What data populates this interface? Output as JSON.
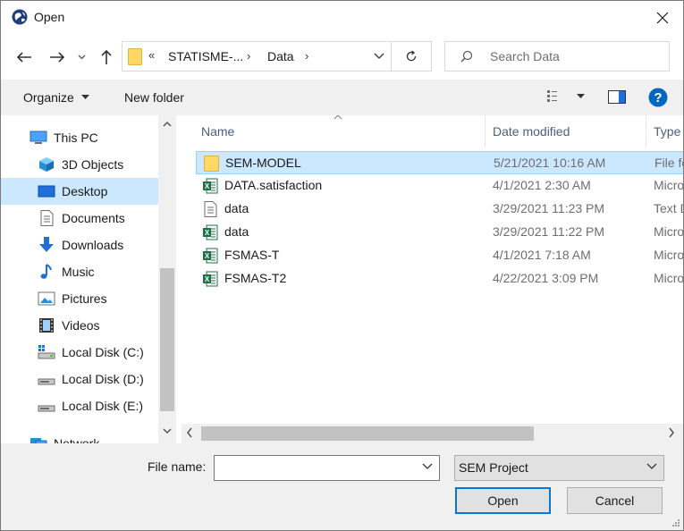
{
  "window": {
    "title": "Open"
  },
  "address": {
    "overflow": "«",
    "crumbs": [
      "STATISME-...",
      "Data"
    ]
  },
  "search": {
    "placeholder": "Search Data"
  },
  "toolbar": {
    "organize": "Organize",
    "new_folder": "New folder"
  },
  "sidebar": {
    "items": [
      {
        "label": "This PC",
        "icon": "computer-icon"
      },
      {
        "label": "3D Objects",
        "icon": "cube-icon"
      },
      {
        "label": "Desktop",
        "icon": "desktop-icon",
        "selected": true
      },
      {
        "label": "Documents",
        "icon": "document-icon"
      },
      {
        "label": "Downloads",
        "icon": "download-arrow-icon"
      },
      {
        "label": "Music",
        "icon": "music-note-icon"
      },
      {
        "label": "Pictures",
        "icon": "picture-icon"
      },
      {
        "label": "Videos",
        "icon": "film-icon"
      },
      {
        "label": "Local Disk (C:)",
        "icon": "drive-windows-icon"
      },
      {
        "label": "Local Disk (D:)",
        "icon": "drive-icon"
      },
      {
        "label": "Local Disk (E:)",
        "icon": "drive-icon"
      },
      {
        "label": "Network",
        "icon": "network-icon"
      }
    ]
  },
  "columns": {
    "name": "Name",
    "date": "Date modified",
    "type": "Type"
  },
  "files": [
    {
      "name": "SEM-MODEL",
      "date": "5/21/2021 10:16 AM",
      "type": "File fo",
      "icon": "folder-icon",
      "selected": true
    },
    {
      "name": "DATA.satisfaction",
      "date": "4/1/2021 2:30 AM",
      "type": "Micro",
      "icon": "excel-icon"
    },
    {
      "name": "data",
      "date": "3/29/2021 11:23 PM",
      "type": "Text D",
      "icon": "text-file-icon"
    },
    {
      "name": "data",
      "date": "3/29/2021 11:22 PM",
      "type": "Micro",
      "icon": "excel-icon"
    },
    {
      "name": "FSMAS-T",
      "date": "4/1/2021 7:18 AM",
      "type": "Micro",
      "icon": "excel-icon"
    },
    {
      "name": "FSMAS-T2",
      "date": "4/22/2021 3:09 PM",
      "type": "Micro",
      "icon": "excel-icon"
    }
  ],
  "footer": {
    "file_name_label": "File name:",
    "file_name_value": "",
    "file_type": "SEM Project",
    "open": "Open",
    "cancel": "Cancel"
  },
  "colors": {
    "accent": "#0078d7",
    "selection": "#cce8ff",
    "help": "#0067c0",
    "folder": "#ffd866",
    "excel": "#1d7044"
  }
}
